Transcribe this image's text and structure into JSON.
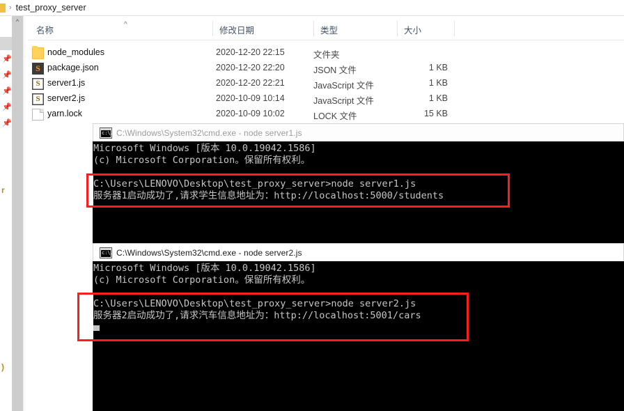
{
  "explorer": {
    "breadcrumb": {
      "separator": "›",
      "path": "test_proxy_server"
    },
    "columns": [
      {
        "label": "名称",
        "sorted": "ascending"
      },
      {
        "label": "修改日期"
      },
      {
        "label": "类型"
      },
      {
        "label": "大小"
      }
    ],
    "files": [
      {
        "name": "node_modules",
        "icon": "folder-icon",
        "icon_text": "",
        "date": "2020-12-20 22:15",
        "type": "文件夹",
        "size": ""
      },
      {
        "name": "package.json",
        "icon": "sublime-text-icon",
        "icon_text": "S",
        "date": "2020-12-20 22:20",
        "type": "JSON 文件",
        "size": "1 KB"
      },
      {
        "name": "server1.js",
        "icon": "javascript-icon",
        "icon_text": "S",
        "date": "2020-12-20 22:21",
        "type": "JavaScript 文件",
        "size": "1 KB"
      },
      {
        "name": "server2.js",
        "icon": "javascript-icon",
        "icon_text": "S",
        "date": "2020-10-09 10:14",
        "type": "JavaScript 文件",
        "size": "1 KB"
      },
      {
        "name": "yarn.lock",
        "icon": "generic-file-icon",
        "icon_text": "",
        "date": "2020-10-09 10:02",
        "type": "LOCK 文件",
        "size": "15 KB"
      }
    ],
    "nav_rail": {
      "pin_glyph": "📌",
      "pin_count": 5,
      "cut_label_top": "r",
      "cut_label_bottom": ")"
    }
  },
  "cmd_windows": [
    {
      "id": "cmd-server1",
      "title": "C:\\Windows\\System32\\cmd.exe - node  server1.js",
      "icon": "cmd-icon",
      "icon_text": "c:\\.",
      "active": false,
      "lines_before": [
        "Microsoft Windows [版本 10.0.19042.1586]",
        "(c) Microsoft Corporation。保留所有权利。",
        ""
      ],
      "highlighted_lines": [
        "C:\\Users\\LENOVO\\Desktop\\test_proxy_server>node server1.js",
        "服务器1启动成功了,请求学生信息地址为：http://localhost:5000/students"
      ],
      "lines_after": []
    },
    {
      "id": "cmd-server2",
      "title": "C:\\Windows\\System32\\cmd.exe - node  server2.js",
      "icon": "cmd-icon",
      "icon_text": "c:\\.",
      "active": true,
      "lines_before": [
        "Microsoft Windows [版本 10.0.19042.1586]",
        "(c) Microsoft Corporation。保留所有权利。",
        ""
      ],
      "highlighted_lines": [
        "C:\\Users\\LENOVO\\Desktop\\test_proxy_server>node server2.js",
        "服务器2启动成功了,请求汽车信息地址为：http://localhost:5001/cars"
      ],
      "lines_after": [
        ""
      ]
    }
  ],
  "annotations": {
    "highlight_color": "#fe1d1d",
    "boxes": [
      {
        "name": "server1-output-highlight"
      },
      {
        "name": "server2-output-highlight"
      }
    ]
  }
}
